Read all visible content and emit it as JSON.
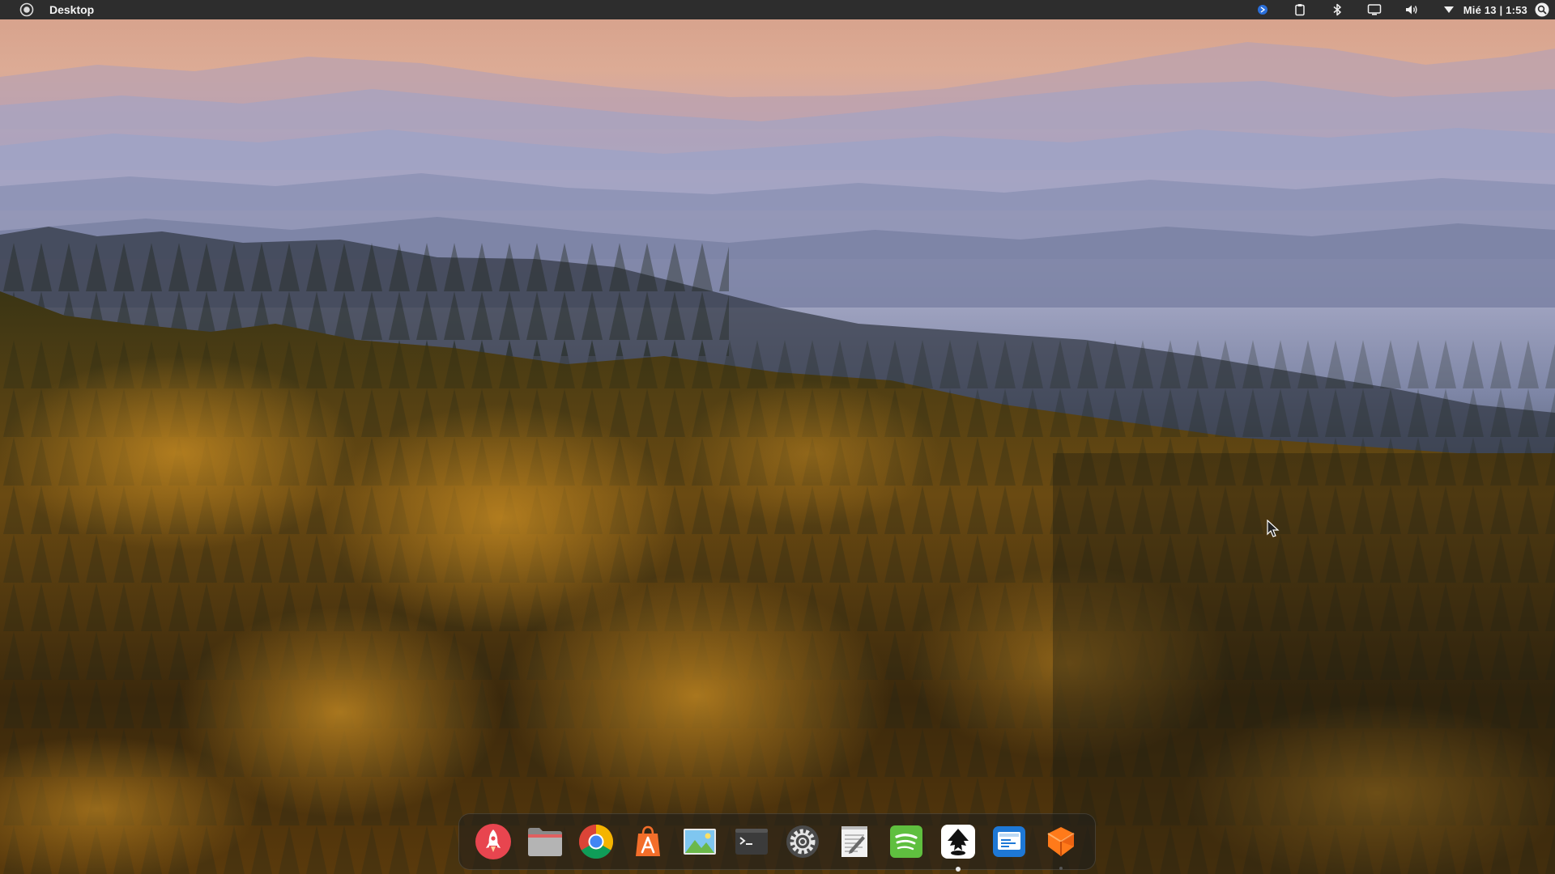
{
  "panel": {
    "title": "Desktop",
    "datetime": "Mié 13 | 1:53",
    "indicators": [
      "blue-status-icon",
      "clipboard-icon",
      "bluetooth-icon",
      "display-icon",
      "volume-icon",
      "network-icon",
      "search-icon"
    ]
  },
  "dock": {
    "apps": [
      {
        "name": "launcher-rocket",
        "icon": "rocket-icon",
        "running": false
      },
      {
        "name": "files",
        "icon": "folder-icon",
        "running": false
      },
      {
        "name": "chrome",
        "icon": "chrome-icon",
        "running": false
      },
      {
        "name": "app-store",
        "icon": "app-store-icon",
        "running": false
      },
      {
        "name": "image-viewer",
        "icon": "image-icon",
        "running": false
      },
      {
        "name": "terminal",
        "icon": "terminal-icon",
        "running": false
      },
      {
        "name": "settings",
        "icon": "gear-icon",
        "running": false
      },
      {
        "name": "text-editor",
        "icon": "notepad-icon",
        "running": false
      },
      {
        "name": "spotify",
        "icon": "spotify-icon",
        "running": false
      },
      {
        "name": "inkscape",
        "icon": "inkscape-icon",
        "running": true
      },
      {
        "name": "screenshot",
        "icon": "screenshot-icon",
        "running": false
      },
      {
        "name": "sublime-merge",
        "icon": "sublime-icon",
        "running": false
      }
    ]
  },
  "colors": {
    "panel_bg": "#2d2d2d",
    "sky_top": "#d9a48a",
    "mist": "#9aa0c4",
    "forest_gold": "#b07a1c"
  }
}
